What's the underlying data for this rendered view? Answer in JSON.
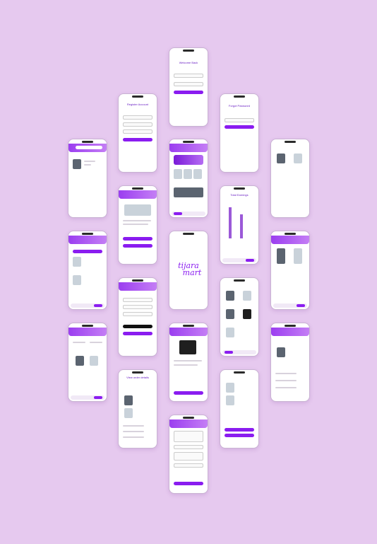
{
  "palette": {
    "background": "#e6c9ef",
    "accent": "#8a1cf0",
    "accent_light": "#c47ef5"
  },
  "screens": {
    "login": {
      "title": "Welcome Back",
      "email": "E-Mail",
      "password": "Password",
      "button": "Sign In"
    },
    "register": {
      "title": "Register Account",
      "full_name": "Full Name",
      "email": "E-Mail",
      "password": "Password",
      "button": "Sign Up"
    },
    "forgot": {
      "title": "Forgot Password",
      "button": "Confirm"
    },
    "home": {
      "banner": "Cashback 15%",
      "section": "Best Of The Day"
    },
    "product": {
      "button": "Buy Now",
      "rate": "Rate This Product"
    },
    "splash": {
      "logo_top": "tijara",
      "logo_bottom": "mart"
    },
    "orders": {
      "title": "Total Earnings"
    },
    "payment": {
      "button": "Pay with G Pay"
    },
    "add_product": {
      "title": "Add Product",
      "button": "Add"
    },
    "order_details": {
      "title": "View order details",
      "purchase": "Purchase details",
      "tracking": "Tracking"
    }
  }
}
